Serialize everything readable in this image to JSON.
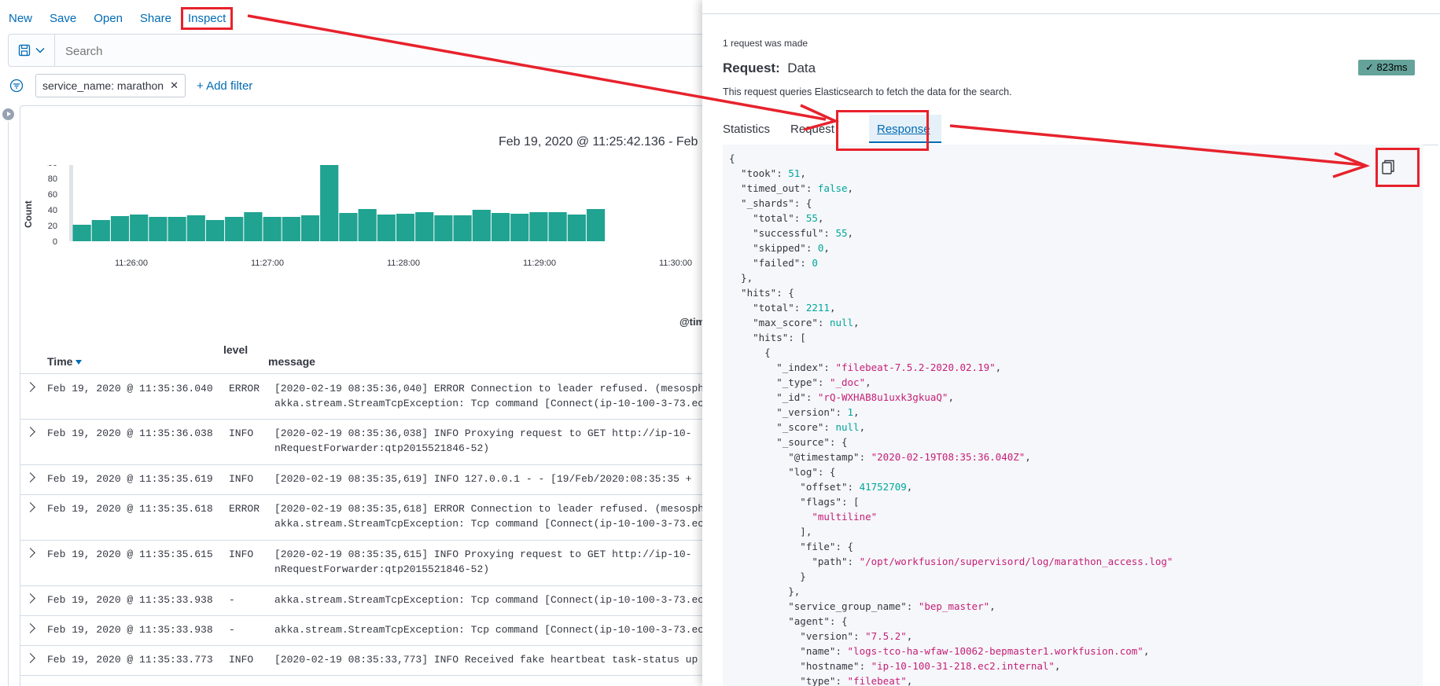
{
  "topnav": {
    "new_label": "New",
    "save_label": "Save",
    "open_label": "Open",
    "share_label": "Share",
    "inspect_label": "Inspect"
  },
  "search": {
    "placeholder": "Search"
  },
  "filters": {
    "pill_label": "service_name: marathon",
    "add_label": "+ Add filter"
  },
  "chart_data": {
    "type": "bar",
    "title": "Feb 19, 2020 @ 11:25:42.136 - Feb",
    "ylabel": "Count",
    "xlabel": "@tim",
    "ylim": [
      0,
      110
    ],
    "yticks": [
      0,
      20,
      40,
      60,
      80,
      100
    ],
    "xticks": [
      "11:26:00",
      "11:27:00",
      "11:28:00",
      "11:29:00",
      "11:30:00"
    ],
    "values": [
      21,
      27,
      32,
      34,
      31,
      31,
      33,
      27,
      31,
      37,
      31,
      31,
      33,
      105,
      36,
      41,
      34,
      35,
      37,
      33,
      33,
      40,
      36,
      35,
      37,
      37,
      34,
      41
    ],
    "bar_color": "#20a391"
  },
  "table": {
    "headers": {
      "time": "Time",
      "level": "level",
      "message": "message"
    },
    "rows": [
      {
        "time": "Feb 19, 2020 @ 11:35:36.040",
        "level": "ERROR",
        "msg1": "[2020-02-19 08:35:36,040] ERROR Connection to leader refused. (mesosph",
        "msg2": "akka.stream.StreamTcpException: Tcp command [Connect(ip-10-100-3-73.ec"
      },
      {
        "time": "Feb 19, 2020 @ 11:35:36.038",
        "level": "INFO",
        "msg1": "[2020-02-19 08:35:36,038] INFO  Proxying request to GET http://ip-10-",
        "msg2": "nRequestForwarder:qtp2015521846-52)"
      },
      {
        "time": "Feb 19, 2020 @ 11:35:35.619",
        "level": "INFO",
        "msg1": "[2020-02-19 08:35:35,619] INFO  127.0.0.1 - - [19/Feb/2020:08:35:35 +",
        "msg2": ""
      },
      {
        "time": "Feb 19, 2020 @ 11:35:35.618",
        "level": "ERROR",
        "msg1": "[2020-02-19 08:35:35,618] ERROR Connection to leader refused. (mesosph",
        "msg2": "akka.stream.StreamTcpException: Tcp command [Connect(ip-10-100-3-73.ec"
      },
      {
        "time": "Feb 19, 2020 @ 11:35:35.615",
        "level": "INFO",
        "msg1": "[2020-02-19 08:35:35,615] INFO  Proxying request to GET http://ip-10-",
        "msg2": "nRequestForwarder:qtp2015521846-52)"
      },
      {
        "time": "Feb 19, 2020 @ 11:35:33.938",
        "level": " -",
        "msg1": "akka.stream.StreamTcpException: Tcp command [Connect(ip-10-100-3-73.ec",
        "msg2": ""
      },
      {
        "time": "Feb 19, 2020 @ 11:35:33.938",
        "level": " -",
        "msg1": "akka.stream.StreamTcpException: Tcp command [Connect(ip-10-100-3-73.ec",
        "msg2": ""
      },
      {
        "time": "Feb 19, 2020 @ 11:35:33.773",
        "level": "INFO",
        "msg1": "[2020-02-19 08:35:33,773] INFO  Received fake heartbeat task-status up",
        "msg2": ""
      }
    ]
  },
  "inspector": {
    "request_count": "1 request was made",
    "request_label": "Request:",
    "request_name": "Data",
    "timing_badge": "✓ 823ms",
    "description": "This request queries Elasticsearch to fetch the data for the search.",
    "tabs": {
      "statistics": "Statistics",
      "request": "Request",
      "response": "Response"
    },
    "response_lines": [
      [
        [
          "p",
          "{"
        ]
      ],
      [
        [
          "p",
          "  \"took\": "
        ],
        [
          "n",
          "51"
        ],
        [
          "p",
          ","
        ]
      ],
      [
        [
          "p",
          "  \"timed_out\": "
        ],
        [
          "n",
          "false"
        ],
        [
          "p",
          ","
        ]
      ],
      [
        [
          "p",
          "  \"_shards\": {"
        ]
      ],
      [
        [
          "p",
          "    \"total\": "
        ],
        [
          "n",
          "55"
        ],
        [
          "p",
          ","
        ]
      ],
      [
        [
          "p",
          "    \"successful\": "
        ],
        [
          "n",
          "55"
        ],
        [
          "p",
          ","
        ]
      ],
      [
        [
          "p",
          "    \"skipped\": "
        ],
        [
          "n",
          "0"
        ],
        [
          "p",
          ","
        ]
      ],
      [
        [
          "p",
          "    \"failed\": "
        ],
        [
          "n",
          "0"
        ]
      ],
      [
        [
          "p",
          "  },"
        ]
      ],
      [
        [
          "p",
          "  \"hits\": {"
        ]
      ],
      [
        [
          "p",
          "    \"total\": "
        ],
        [
          "n",
          "2211"
        ],
        [
          "p",
          ","
        ]
      ],
      [
        [
          "p",
          "    \"max_score\": "
        ],
        [
          "n",
          "null"
        ],
        [
          "p",
          ","
        ]
      ],
      [
        [
          "p",
          "    \"hits\": ["
        ]
      ],
      [
        [
          "p",
          "      {"
        ]
      ],
      [
        [
          "p",
          "        \"_index\": "
        ],
        [
          "s",
          "\"filebeat-7.5.2-2020.02.19\""
        ],
        [
          "p",
          ","
        ]
      ],
      [
        [
          "p",
          "        \"_type\": "
        ],
        [
          "s",
          "\"_doc\""
        ],
        [
          "p",
          ","
        ]
      ],
      [
        [
          "p",
          "        \"_id\": "
        ],
        [
          "s",
          "\"rQ-WXHAB8u1uxk3gkuaQ\""
        ],
        [
          "p",
          ","
        ]
      ],
      [
        [
          "p",
          "        \"_version\": "
        ],
        [
          "n",
          "1"
        ],
        [
          "p",
          ","
        ]
      ],
      [
        [
          "p",
          "        \"_score\": "
        ],
        [
          "n",
          "null"
        ],
        [
          "p",
          ","
        ]
      ],
      [
        [
          "p",
          "        \"_source\": {"
        ]
      ],
      [
        [
          "p",
          "          \"@timestamp\": "
        ],
        [
          "s",
          "\"2020-02-19T08:35:36.040Z\""
        ],
        [
          "p",
          ","
        ]
      ],
      [
        [
          "p",
          "          \"log\": {"
        ]
      ],
      [
        [
          "p",
          "            \"offset\": "
        ],
        [
          "n",
          "41752709"
        ],
        [
          "p",
          ","
        ]
      ],
      [
        [
          "p",
          "            \"flags\": ["
        ]
      ],
      [
        [
          "p",
          "              "
        ],
        [
          "s",
          "\"multiline\""
        ]
      ],
      [
        [
          "p",
          "            ],"
        ]
      ],
      [
        [
          "p",
          "            \"file\": {"
        ]
      ],
      [
        [
          "p",
          "              \"path\": "
        ],
        [
          "s",
          "\"/opt/workfusion/supervisord/log/marathon_access.log\""
        ]
      ],
      [
        [
          "p",
          "            }"
        ]
      ],
      [
        [
          "p",
          "          },"
        ]
      ],
      [
        [
          "p",
          "          \"service_group_name\": "
        ],
        [
          "s",
          "\"bep_master\""
        ],
        [
          "p",
          ","
        ]
      ],
      [
        [
          "p",
          "          \"agent\": {"
        ]
      ],
      [
        [
          "p",
          "            \"version\": "
        ],
        [
          "s",
          "\"7.5.2\""
        ],
        [
          "p",
          ","
        ]
      ],
      [
        [
          "p",
          "            \"name\": "
        ],
        [
          "s",
          "\"logs-tco-ha-wfaw-10062-bepmaster1.workfusion.com\""
        ],
        [
          "p",
          ","
        ]
      ],
      [
        [
          "p",
          "            \"hostname\": "
        ],
        [
          "s",
          "\"ip-10-100-31-218.ec2.internal\""
        ],
        [
          "p",
          ","
        ]
      ],
      [
        [
          "p",
          "            \"type\": "
        ],
        [
          "s",
          "\"filebeat\""
        ],
        [
          "p",
          ","
        ]
      ]
    ]
  },
  "annotation_color": "#e7222c"
}
